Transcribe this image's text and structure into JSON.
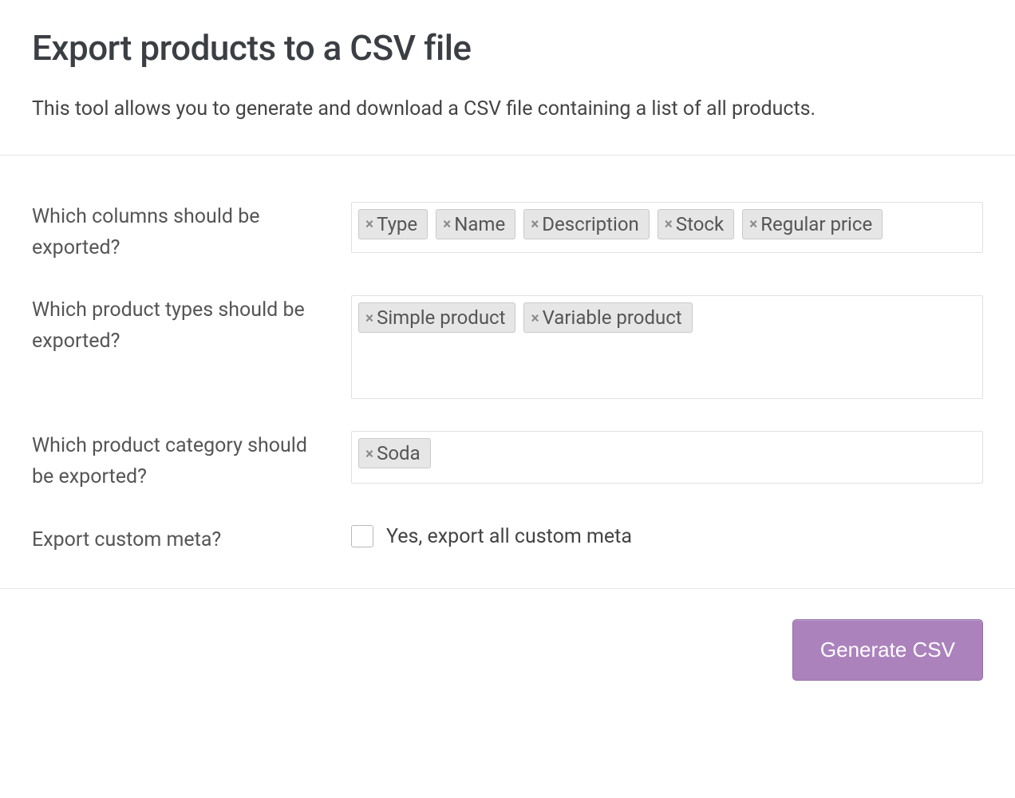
{
  "title": "Export products to a CSV file",
  "description": "This tool allows you to generate and download a CSV file containing a list of all products.",
  "fields": {
    "columns": {
      "label": "Which columns should be exported?",
      "selected": [
        "Type",
        "Name",
        "Description",
        "Stock",
        "Regular price"
      ]
    },
    "types": {
      "label": "Which product types should be exported?",
      "selected": [
        "Simple product",
        "Variable product"
      ]
    },
    "category": {
      "label": "Which product category should be exported?",
      "selected": [
        "Soda"
      ]
    },
    "meta": {
      "label": "Export custom meta?",
      "checkbox_label": "Yes, export all custom meta",
      "checked": false
    }
  },
  "actions": {
    "generate": "Generate CSV"
  }
}
